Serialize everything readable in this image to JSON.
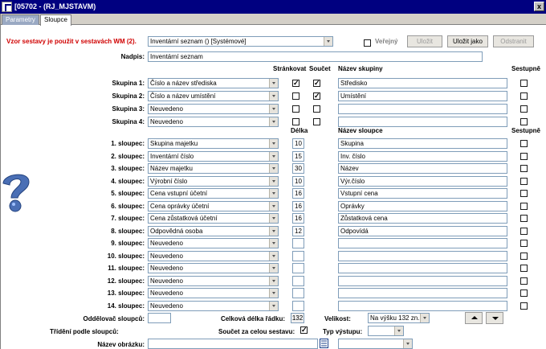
{
  "window": {
    "title": "[05702 - (RJ_MJSTAVM)",
    "close": "x"
  },
  "tabs": [
    {
      "label": "Parametry",
      "active": false
    },
    {
      "label": "Sloupce",
      "active": true
    }
  ],
  "template": {
    "label": "Vzor sestavy je použit v sestavách WM (2).",
    "value": "Inventární seznam   ()   [Systémové]",
    "public_label": "Veřejný",
    "public_checked": false,
    "save_label": "Uložit",
    "save_as_label": "Uložit jako",
    "delete_label": "Odstranit"
  },
  "heading": {
    "label": "Nadpis:",
    "value": "Inventární seznam"
  },
  "group_headers": {
    "paging": "Stránkovat",
    "sum": "Součet",
    "name": "Název skupiny",
    "desc": "Sestupně"
  },
  "groups": [
    {
      "label": "Skupina 1:",
      "value": "Číslo a název střediska",
      "paging": true,
      "sum": true,
      "name": "Středisko",
      "desc": false
    },
    {
      "label": "Skupina 2:",
      "value": "Číslo a název umístění",
      "paging": false,
      "sum": true,
      "name": "Umístění",
      "desc": false
    },
    {
      "label": "Skupina 3:",
      "value": "Neuvedeno",
      "paging": false,
      "sum": false,
      "name": "",
      "desc": false
    },
    {
      "label": "Skupina 4:",
      "value": "Neuvedeno",
      "paging": false,
      "sum": false,
      "name": "",
      "desc": false
    }
  ],
  "column_headers": {
    "length": "Délka",
    "name": "Název sloupce",
    "desc": "Sestupně"
  },
  "columns": [
    {
      "label": "1. sloupec:",
      "value": "Skupina majetku",
      "length": "10",
      "name": "Skupina",
      "desc": false
    },
    {
      "label": "2. sloupec:",
      "value": "Inventární číslo",
      "length": "15",
      "name": "Inv. číslo",
      "desc": false
    },
    {
      "label": "3. sloupec:",
      "value": "Název majetku",
      "length": "30",
      "name": "Název",
      "desc": false
    },
    {
      "label": "4. sloupec:",
      "value": "Výrobní číslo",
      "length": "10",
      "name": "Výr.číslo",
      "desc": false
    },
    {
      "label": "5. sloupec:",
      "value": "Cena vstupní účetní",
      "length": "16",
      "name": "Vstupní cena",
      "desc": false
    },
    {
      "label": "6. sloupec:",
      "value": "Cena oprávky účetní",
      "length": "16",
      "name": "Oprávky",
      "desc": false
    },
    {
      "label": "7. sloupec:",
      "value": "Cena zůstatková účetní",
      "length": "16",
      "name": "Zůstatková cena",
      "desc": false
    },
    {
      "label": "8. sloupec:",
      "value": "Odpovědná osoba",
      "length": "12",
      "name": "Odpovídá",
      "desc": false
    },
    {
      "label": "9. sloupec:",
      "value": "Neuvedeno",
      "length": "",
      "name": "",
      "desc": false
    },
    {
      "label": "10. sloupec:",
      "value": "Neuvedeno",
      "length": "",
      "name": "",
      "desc": false
    },
    {
      "label": "11. sloupec:",
      "value": "Neuvedeno",
      "length": "",
      "name": "",
      "desc": false
    },
    {
      "label": "12. sloupec:",
      "value": "Neuvedeno",
      "length": "",
      "name": "",
      "desc": false
    },
    {
      "label": "13. sloupec:",
      "value": "Neuvedeno",
      "length": "",
      "name": "",
      "desc": false
    },
    {
      "label": "14. sloupec:",
      "value": "Neuvedeno",
      "length": "",
      "name": "",
      "desc": false
    }
  ],
  "footer": {
    "separator_label": "Oddělovač sloupců:",
    "separator_value": "",
    "row_length_label": "Celková délka řádku:",
    "row_length_value": "132",
    "size_label": "Velikost:",
    "size_value": "Na výšku 132 zn.",
    "sort_label": "Třídění podle sloupců:",
    "sort_value": "",
    "sum_all_label": "Součet za celou sestavu:",
    "sum_all_checked": true,
    "output_label": "Typ výstupu:",
    "output_value": "",
    "image_label": "Název obrázku:",
    "image_value": "",
    "image_extra_value": ""
  },
  "colors": {
    "titlebar": "#000080",
    "required_label": "#d00000",
    "field_border": "#7f9db9",
    "help_icon": "#4a6fb5"
  }
}
